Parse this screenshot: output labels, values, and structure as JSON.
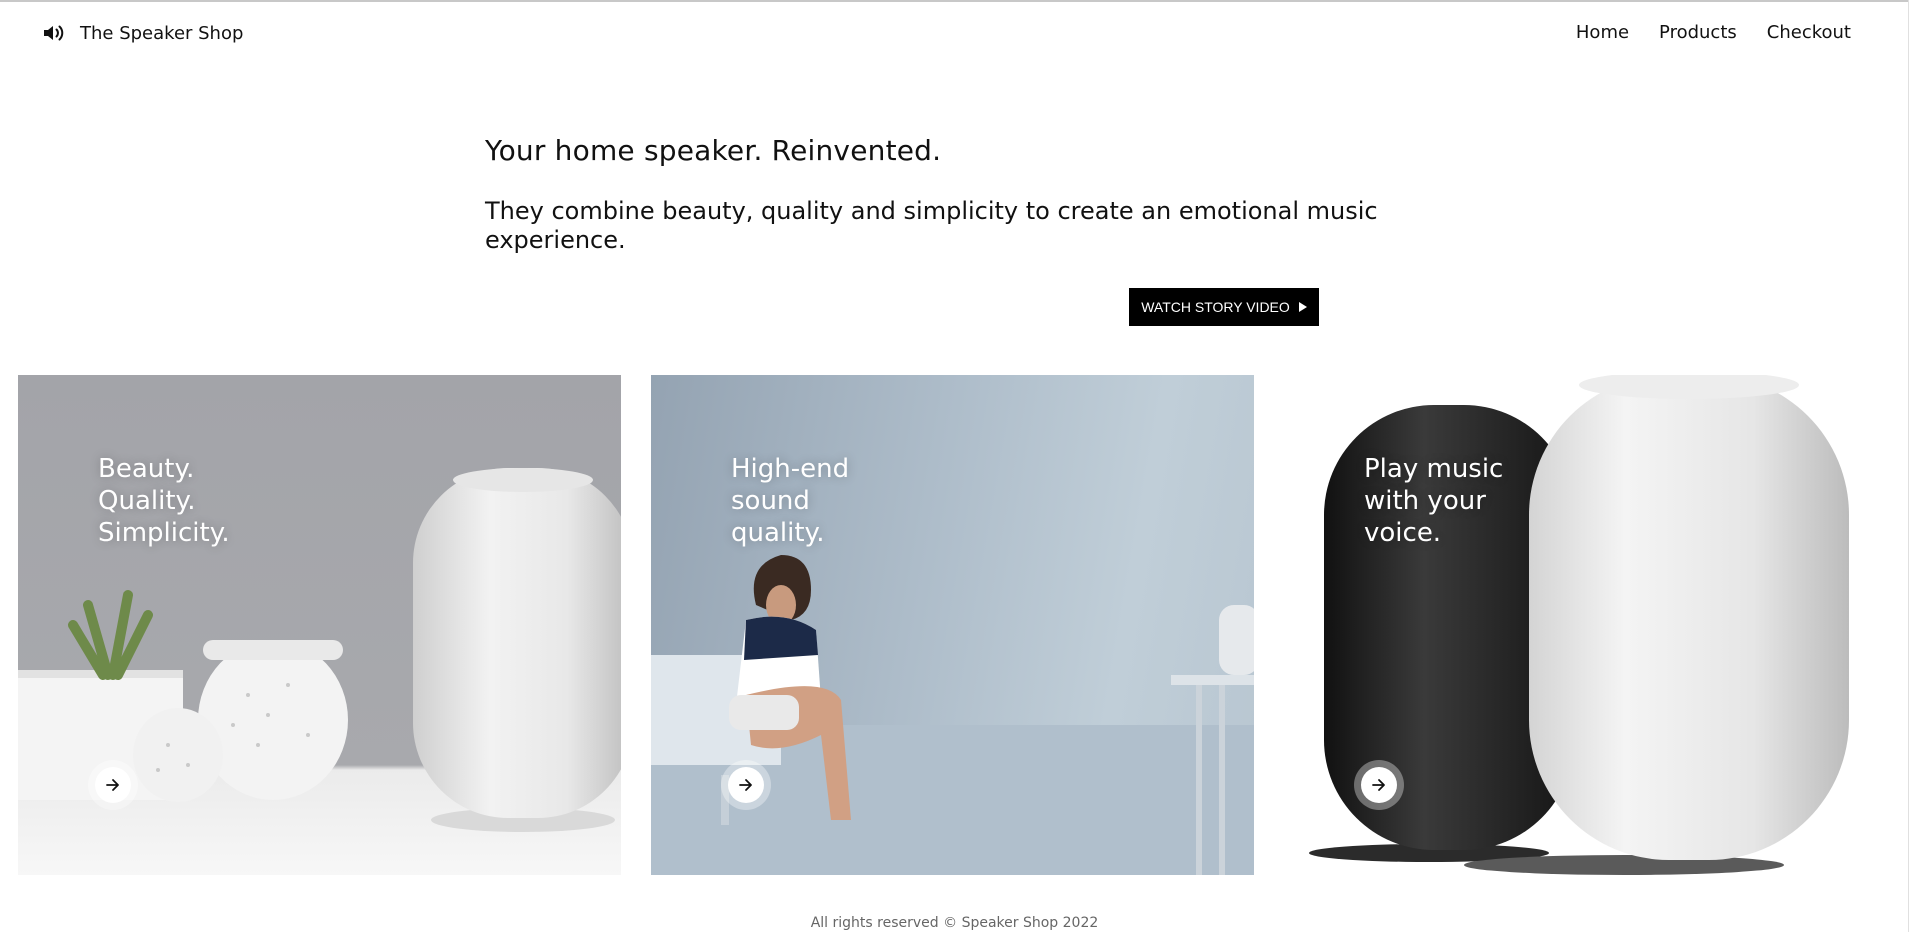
{
  "header": {
    "brand_icon": "speaker-volume-icon",
    "brand_name": "The Speaker Shop",
    "nav": [
      {
        "label": "Home"
      },
      {
        "label": "Products"
      },
      {
        "label": "Checkout"
      }
    ]
  },
  "hero": {
    "title": "Your home speaker. Reinvented.",
    "description": "They combine beauty, quality and simplicity to create an emotional music experience.",
    "cta_label": "WATCH STORY VIDEO",
    "cta_icon": "play-icon"
  },
  "cards": [
    {
      "lines": [
        "Beauty.",
        "Quality.",
        "Simplicity."
      ],
      "button_icon": "arrow-right-icon"
    },
    {
      "lines": [
        "High-end",
        "sound",
        "quality."
      ],
      "button_icon": "arrow-right-icon"
    },
    {
      "lines": [
        "Play music",
        "with your",
        "voice."
      ],
      "button_icon": "arrow-right-icon"
    }
  ],
  "footer": {
    "text": "All rights reserved © Speaker Shop 2022"
  },
  "colors": {
    "accent": "#000000",
    "text": "#111111",
    "footer_text": "#666666",
    "background": "#ffffff"
  }
}
